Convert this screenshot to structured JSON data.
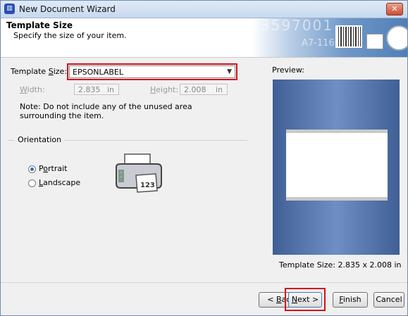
{
  "window": {
    "title": "New Document Wizard",
    "close_glyph": "✕"
  },
  "header": {
    "title": "Template Size",
    "subtitle": "Specify the size of your item.",
    "banner_number": "3597001",
    "banner_code": "A7-116"
  },
  "form": {
    "template_size": {
      "label_pre": "Template ",
      "label_key": "S",
      "label_post": "ize:",
      "value": "EPSONLABEL"
    },
    "width": {
      "label_key": "W",
      "label_post": "idth:",
      "value": "2.835",
      "unit": "in"
    },
    "height": {
      "label_key": "H",
      "label_post": "eight:",
      "value": "2.008",
      "unit": "in"
    },
    "note": "Note: Do not include any of the unused area surrounding the item."
  },
  "orientation": {
    "group_label": "Orientation",
    "options": [
      {
        "pre": "P",
        "key": "o",
        "post": "rtrait",
        "checked": true
      },
      {
        "pre": "",
        "key": "L",
        "post": "andscape",
        "checked": false
      }
    ],
    "printer_label": "123"
  },
  "preview": {
    "label": "Preview:",
    "size_text": "Template Size:  2.835 x 2.008 in"
  },
  "buttons": {
    "back": {
      "pre": "< ",
      "key": "B",
      "post": "ack"
    },
    "next": {
      "key": "N",
      "post": "ext >"
    },
    "finish": {
      "key": "F",
      "post": "inish"
    },
    "cancel": {
      "text": "Cancel"
    }
  },
  "colors": {
    "highlight": "#d1121e",
    "preview_bg": "#5a7bb3"
  }
}
